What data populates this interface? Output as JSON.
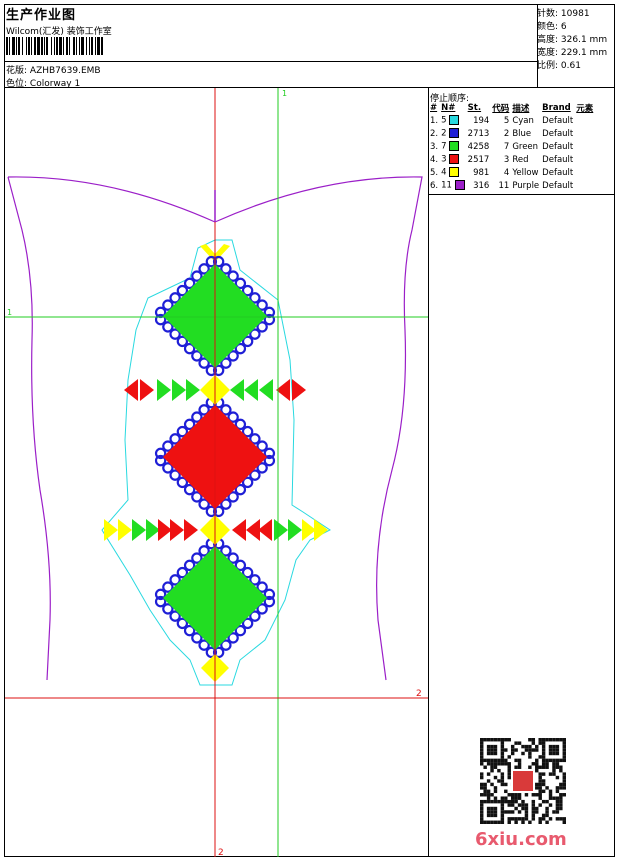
{
  "header": {
    "title": "生产作业图",
    "company": "Wilcom(汇发) 装饰工作室",
    "design_label": "花版:",
    "design_value": "AZHB7639.EMB",
    "colorway_label": "色位:",
    "colorway_value": "Colorway 1"
  },
  "stats": [
    {
      "label": "针数:",
      "value": "10981"
    },
    {
      "label": "颜色:",
      "value": "6"
    },
    {
      "label": "高度:",
      "value": "326.1 mm"
    },
    {
      "label": "宽度:",
      "value": "229.1 mm"
    },
    {
      "label": "比例:",
      "value": "0.61"
    }
  ],
  "sequence": {
    "title": "停止顺序:",
    "headers": [
      "#",
      "N#",
      "St.",
      "代码",
      "描述",
      "Brand",
      "元素"
    ],
    "rows": [
      {
        "idx": "1.",
        "n": "5",
        "color": "#29d9e0",
        "st": "194",
        "code": "5",
        "desc": "Cyan",
        "brand": "Default"
      },
      {
        "idx": "2.",
        "n": "2",
        "color": "#1f1fd6",
        "st": "2713",
        "code": "2",
        "desc": "Blue",
        "brand": "Default"
      },
      {
        "idx": "3.",
        "n": "7",
        "color": "#22dd22",
        "st": "4258",
        "code": "7",
        "desc": "Green",
        "brand": "Default"
      },
      {
        "idx": "4.",
        "n": "3",
        "color": "#ee1111",
        "st": "2517",
        "code": "3",
        "desc": "Red",
        "brand": "Default"
      },
      {
        "idx": "5.",
        "n": "4",
        "color": "#ffff00",
        "st": "981",
        "code": "4",
        "desc": "Yellow",
        "brand": "Default"
      },
      {
        "idx": "6.",
        "n": "11",
        "color": "#9b1fc8",
        "st": "316",
        "code": "11",
        "desc": "Purple",
        "brand": "Default"
      }
    ]
  },
  "markers": {
    "h1": "1",
    "v1": "1",
    "h2": "2",
    "v2": "2"
  },
  "watermark": "6xiu.com",
  "colors": {
    "cyan": "#29d9e0",
    "blue": "#1f1fd6",
    "green": "#22dd22",
    "red": "#ee1111",
    "yellow": "#ffff00",
    "purple": "#9b1fc8",
    "guide_green": "#22cc22",
    "guide_red": "#dd1111"
  }
}
